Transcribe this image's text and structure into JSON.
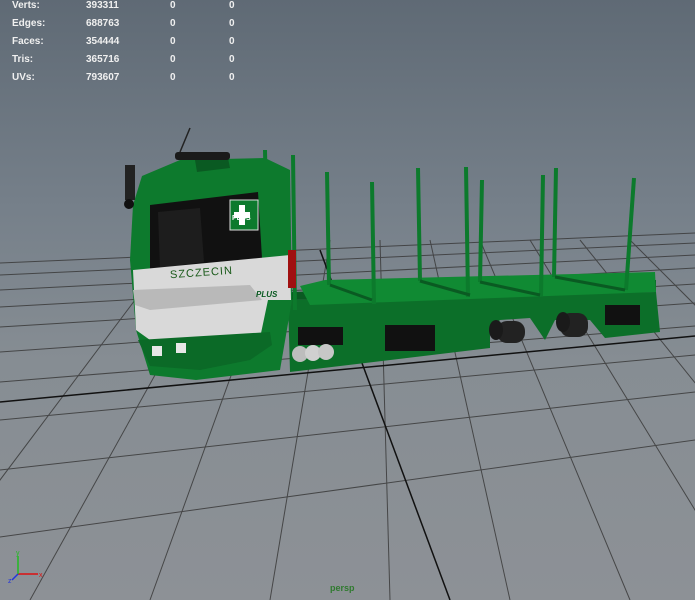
{
  "hud": {
    "rows": [
      {
        "label": "Verts:",
        "v1": "393311",
        "v2": "0",
        "v3": "0"
      },
      {
        "label": "Edges:",
        "v1": "688763",
        "v2": "0",
        "v3": "0"
      },
      {
        "label": "Faces:",
        "v1": "354444",
        "v2": "0",
        "v3": "0"
      },
      {
        "label": "Tris:",
        "v1": "365716",
        "v2": "0",
        "v3": "0"
      },
      {
        "label": "UVs:",
        "v1": "793607",
        "v2": "0",
        "v3": "0"
      }
    ]
  },
  "truck": {
    "cab_text": "SZCZECIN",
    "badge": "PLUS",
    "logo_text": "PLUS"
  },
  "axis": {
    "x": "x",
    "y": "y",
    "z": "z"
  },
  "camera": {
    "label": "persp"
  },
  "colors": {
    "truck_green": "#0c7a2c",
    "hud_text": "#f0f0f0",
    "grid_line": "#2a2a2a"
  }
}
